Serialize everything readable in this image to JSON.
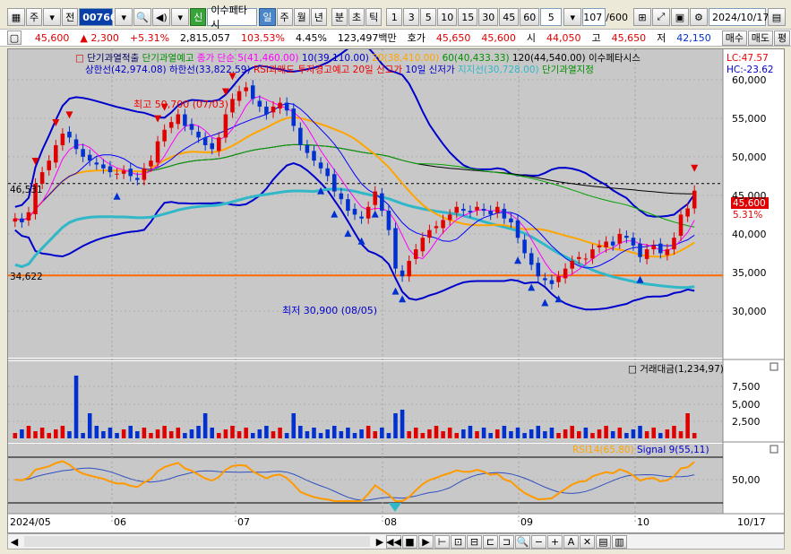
{
  "toolbar": {
    "market_label": "주",
    "prev_label": "전",
    "code": "007660",
    "stock_name": "이수페타시",
    "period_tabs": [
      "일",
      "주",
      "월",
      "년"
    ],
    "minute_tabs": [
      "분",
      "초",
      "틱"
    ],
    "intervals": [
      "1",
      "3",
      "5",
      "10",
      "15",
      "30",
      "45",
      "60"
    ],
    "interval_selected": "5",
    "count": "107",
    "count_total": "/600",
    "date": "2024/10/17",
    "shin_label": "신"
  },
  "quote": {
    "price": "45,600",
    "change": "2,300",
    "change_pct": "+5.31%",
    "volume": "2,815,057",
    "vol_ratio": "103.53%",
    "turnover": "4.45%",
    "amount": "123,497백만",
    "ask_label": "호가",
    "ask": "45,650",
    "bid": "45,600",
    "open_label": "시",
    "open": "44,050",
    "high_label": "고",
    "high": "45,650",
    "low_label": "저",
    "low": "42,150",
    "buy_label": "매수",
    "sell_label": "매도",
    "avg_label": "평"
  },
  "legend": {
    "row1": [
      "단기과열적출",
      "단기과열예고",
      "종가 단순 5(41,460.00)",
      "10(39,110.00)",
      "20(38,410.00)",
      "60(40,433.33)",
      "120(44,540.00)",
      "이수페타시스"
    ],
    "row2": [
      "상한선(42,974.08)",
      "하한선(33,822.59)",
      "RSI과매도",
      "투자경고예고",
      "20일 신고가",
      "10일 신저가",
      "지지선(30,728.00)",
      "단기과열지정"
    ],
    "lc": "LC:47.57",
    "hc": "HC:-23.62",
    "colors": {
      "ma5": "#ff00ff",
      "ma10": "#0000ff",
      "ma20": "#ffa500",
      "ma60": "#00a000",
      "ma120": "#000000",
      "bb": "#0000cc",
      "support": "#30b8c8",
      "hline": "#ff6a00"
    }
  },
  "annotations": {
    "high": "최고 59,700 (07/03)",
    "low": "최저 30,900 (08/05)",
    "left_level_top": "46,531",
    "left_level_bottom": "34,622",
    "price_tag": "45,600",
    "pct_tag": "5.31%"
  },
  "volume_panel": {
    "label": "거래대금(1,234,97)"
  },
  "rsi_panel": {
    "rsi_label": "RSI14(65.80)",
    "signal_label": "Signal 9(55,11)"
  },
  "chart_data": [
    {
      "type": "candlestick",
      "y_ticks": [
        "60,000",
        "55,000",
        "50,000",
        "45,000",
        "40,000",
        "35,000",
        "30,000"
      ],
      "ylim": [
        25000,
        63000
      ],
      "x_labels": [
        "2024/05",
        "06",
        "07",
        "08",
        "09",
        "10",
        "10/17"
      ],
      "closes": [
        42000,
        41500,
        42800,
        46500,
        48000,
        49500,
        51500,
        53000,
        52500,
        51000,
        50000,
        49500,
        49000,
        48500,
        48000,
        47800,
        48200,
        47500,
        47000,
        48500,
        49500,
        52000,
        53500,
        54500,
        55500,
        54000,
        53500,
        52500,
        51500,
        51000,
        52500,
        55500,
        57500,
        58500,
        59000,
        57500,
        56500,
        55500,
        56500,
        57000,
        56000,
        54000,
        51500,
        50500,
        49500,
        48500,
        47500,
        45500,
        44500,
        43000,
        42500,
        42000,
        43500,
        45500,
        43000,
        40500,
        35500,
        34500,
        36500,
        38000,
        39500,
        40500,
        41000,
        41800,
        42500,
        43500,
        43000,
        42800,
        43500,
        43000,
        42500,
        43500,
        42000,
        41500,
        39500,
        37500,
        36000,
        34500,
        34000,
        33500,
        34500,
        35500,
        36500,
        37000,
        36800,
        38000,
        38500,
        39000,
        38500,
        40000,
        39500,
        38500,
        37000,
        38000,
        38500,
        37500,
        38000,
        39500,
        42500,
        43300,
        45600
      ],
      "support": 34622,
      "dashed_level": 46531
    },
    {
      "type": "bar",
      "name": "거래대금",
      "y_ticks": [
        "7,500",
        "5,000",
        "2,500"
      ]
    },
    {
      "type": "line",
      "name": "RSI",
      "y_ticks": [
        "50,00"
      ]
    }
  ],
  "statusbar": {
    "left_arrow": "◀",
    "right_arrow": "▶"
  }
}
